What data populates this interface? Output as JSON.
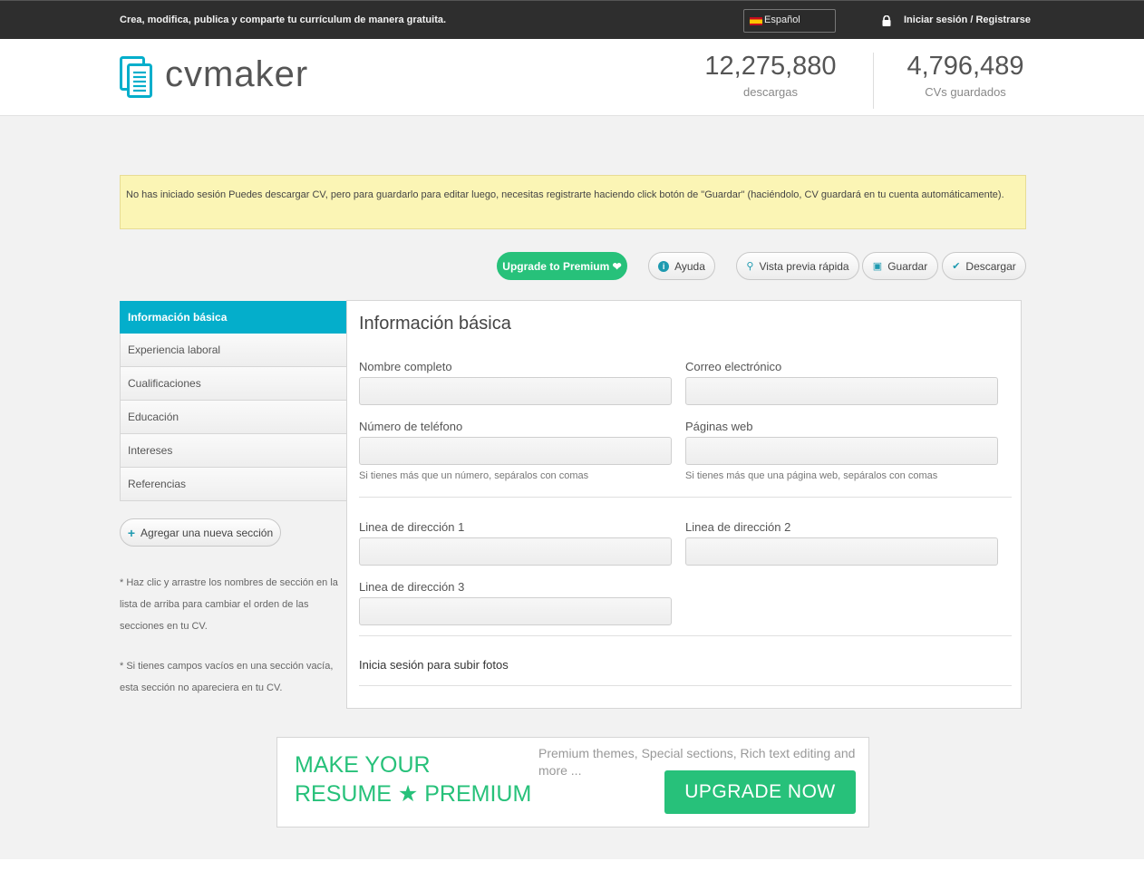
{
  "topbar": {
    "tagline": "Crea, modifica, publica y comparte tu currículum de manera gratuita.",
    "language": "Español",
    "login": "Iniciar sesión / Registrarse"
  },
  "header": {
    "logo": "cvmaker",
    "stats": [
      {
        "value": "12,275,880",
        "label": "descargas"
      },
      {
        "value": "4,796,489",
        "label": "CVs guardados"
      }
    ]
  },
  "notice": "No has iniciado sesión Puedes descargar CV, pero para guardarlo para editar luego, necesitas registrarte haciendo click botón de \"Guardar\" (haciéndolo, CV guardará en tu cuenta automáticamente).",
  "actions": {
    "premium": "Upgrade to Premium ❤",
    "help": "Ayuda",
    "preview": "Vista previa rápida",
    "save": "Guardar",
    "download": "Descargar"
  },
  "sidebar": {
    "items": [
      {
        "label": "Información básica",
        "active": true
      },
      {
        "label": "Experiencia laboral"
      },
      {
        "label": "Cualificaciones"
      },
      {
        "label": "Educación"
      },
      {
        "label": "Intereses"
      },
      {
        "label": "Referencias"
      }
    ],
    "add_section": "Agregar una nueva sección",
    "note1": "* Haz clic y arrastre los nombres de sección en la lista de arriba para cambiar el orden de las secciones en tu CV.",
    "note2": "* Si tienes campos vacíos en una sección vacía, esta sección no apareciera en tu CV."
  },
  "form": {
    "title": "Información básica",
    "full_name": {
      "label": "Nombre completo",
      "value": ""
    },
    "email": {
      "label": "Correo electrónico",
      "value": ""
    },
    "phone": {
      "label": "Número de teléfono",
      "value": "",
      "hint": "Si tienes más que un número, sepáralos con comas"
    },
    "websites": {
      "label": "Páginas web",
      "value": "",
      "hint": "Si tienes más que una página web, sepáralos con comas"
    },
    "address1": {
      "label": "Linea de dirección 1",
      "value": ""
    },
    "address2": {
      "label": "Linea de dirección 2",
      "value": ""
    },
    "address3": {
      "label": "Linea de dirección 3",
      "value": ""
    },
    "photo_note": "Inicia sesión para subir fotos"
  },
  "banner": {
    "headline_line1": "MAKE YOUR",
    "headline_line2": "RESUME ★ PREMIUM",
    "subtitle": "Premium themes, Special sections, Rich text editing and more ...",
    "button": "UPGRADE NOW"
  },
  "colors": {
    "accent": "#04aecb",
    "premium_green": "#27c17a",
    "topbar": "#2e2e2e",
    "notice_bg": "#fbf5b5"
  }
}
